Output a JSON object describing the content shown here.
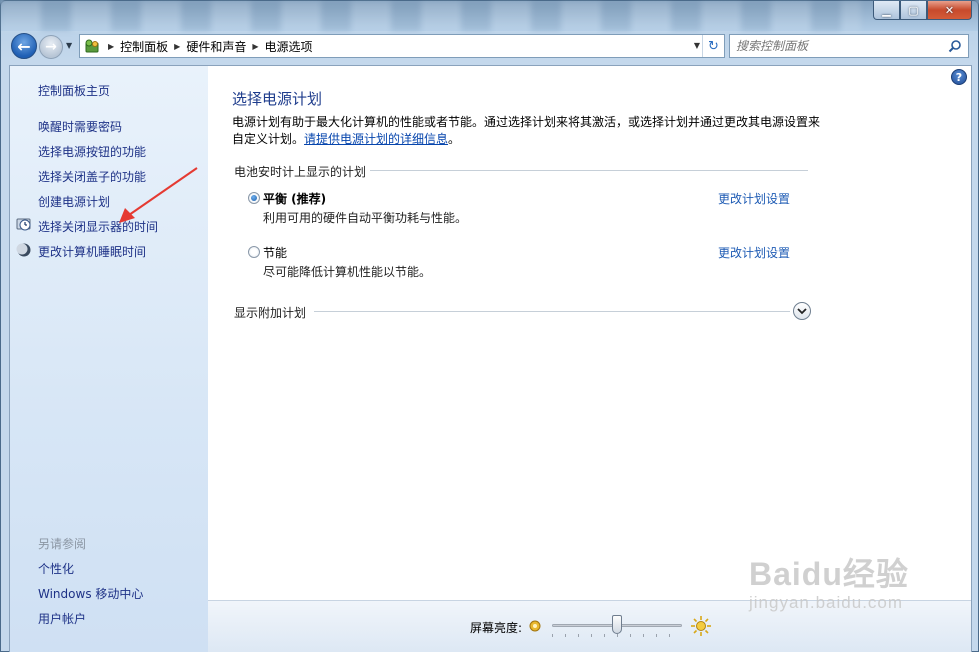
{
  "window": {
    "min_label": "▁",
    "max_label": "▢",
    "close_label": "✕"
  },
  "nav": {
    "breadcrumbs": [
      "控制面板",
      "硬件和声音",
      "电源选项"
    ],
    "search_placeholder": "搜索控制面板",
    "refresh_symbol": "↻"
  },
  "sidebar": {
    "home": "控制面板主页",
    "items": [
      {
        "label": "唤醒时需要密码",
        "icon": "none"
      },
      {
        "label": "选择电源按钮的功能",
        "icon": "none"
      },
      {
        "label": "选择关闭盖子的功能",
        "icon": "none"
      },
      {
        "label": "创建电源计划",
        "icon": "none"
      },
      {
        "label": "选择关闭显示器的时间",
        "icon": "monitor-clock-icon"
      },
      {
        "label": "更改计算机睡眠时间",
        "icon": "moon-icon"
      }
    ],
    "see_also_title": "另请参阅",
    "see_also": [
      "个性化",
      "Windows 移动中心",
      "用户帐户"
    ]
  },
  "main": {
    "help_label": "?",
    "title": "选择电源计划",
    "description": "电源计划有助于最大化计算机的性能或者节能。通过选择计划来将其激活，或选择计划并通过更改其电源设置来自定义计划。",
    "description_link": "请提供电源计划的详细信息",
    "description_end": "。",
    "group_title": "电池安时计上显示的计划",
    "plans": [
      {
        "name": "平衡 (推荐)",
        "desc": "利用可用的硬件自动平衡功耗与性能。",
        "selected": true,
        "link": "更改计划设置"
      },
      {
        "name": "节能",
        "desc": "尽可能降低计算机性能以节能。",
        "selected": false,
        "link": "更改计划设置"
      }
    ],
    "more_plans": "显示附加计划"
  },
  "status": {
    "brightness_label": "屏幕亮度:",
    "brightness_level": 0.5
  },
  "watermark": {
    "logo": "Baidu经验",
    "sub": "jingyan.baidu.com"
  },
  "colors": {
    "link": "#1e3287",
    "title": "#1e3c8c",
    "annotation": "#e53a32"
  }
}
